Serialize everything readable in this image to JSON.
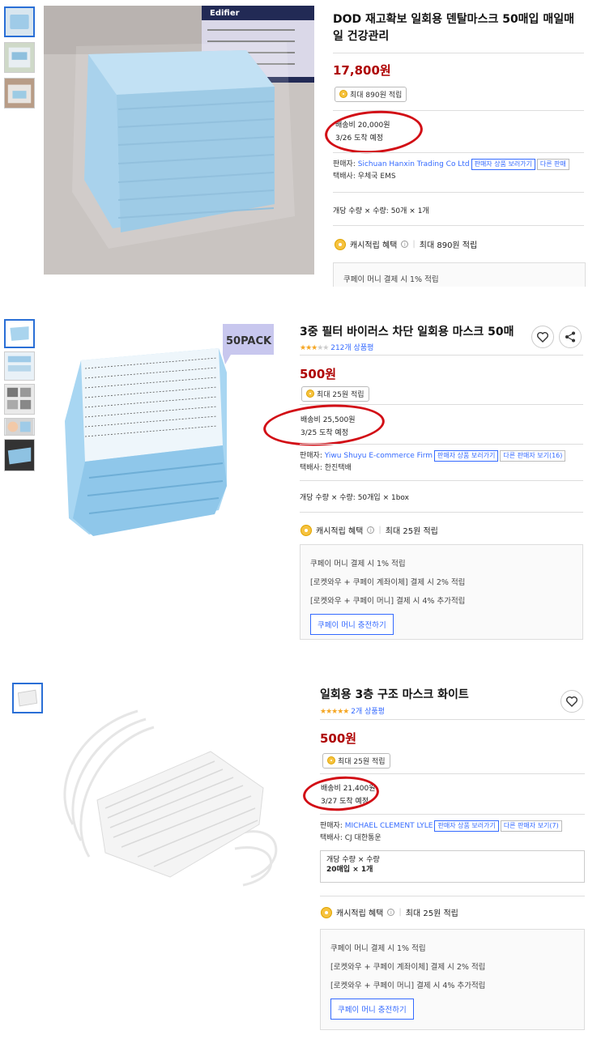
{
  "products": [
    {
      "title": "DOD 재고확보 일회용 덴탈마스크 50매입 매일매일 건강관리",
      "price": "17,800원",
      "reward": "최대 890원 적립",
      "shipping_fee": "배송비 20,000원",
      "arrival": "3/26 도착 예정",
      "seller_label": "판매자:",
      "seller_name": "Sichuan Hanxin Trading Co Ltd",
      "seller_btn": "판매자 상품 보러가기",
      "other_sellers": "다른 판매",
      "carrier": "택배사: 우체국 EMS",
      "quantity": "개당 수량 × 수량: 50개 × 1개",
      "cash_label": "캐시적립 혜택",
      "cash_max": "최대 890원 적립",
      "benefit_line1": "쿠페이 머니 결제 시 1% 적립",
      "box_brand": "Edifier"
    },
    {
      "title": "3중 필터 바이러스 차단 일회용 마스크 50매",
      "rating_count": "212개 상품평",
      "stars": 3,
      "price": "500원",
      "reward": "최대 25원 적립",
      "shipping_fee": "배송비 25,500원",
      "arrival": "3/25 도착 예정",
      "seller_label": "판매자:",
      "seller_name": "Yiwu Shuyu E-commerce Firm",
      "seller_btn": "판매자 상품 보러가기",
      "other_sellers": "다른 판매자 보기(16)",
      "carrier": "택배사: 한진택배",
      "quantity": "개당 수량 × 수량: 50개입 × 1box",
      "cash_label": "캐시적립 혜택",
      "cash_max": "최대 25원 적립",
      "benefit_lines": [
        "쿠페이 머니 결제 시 1% 적립",
        "[로켓와우 + 쿠페이 계좌이체] 결제 시 2% 적립",
        "[로켓와우 + 쿠페이 머니] 결제 시 4% 추가적립"
      ],
      "charge_btn": "쿠페이 머니 충전하기",
      "badge": "50PACK"
    },
    {
      "title": "일회용 3층 구조 마스크 화이트",
      "rating_count": "2개 상품평",
      "stars": 5,
      "price": "500원",
      "reward": "최대 25원 적립",
      "shipping_fee": "배송비 21,400원",
      "arrival": "3/27 도착 예정",
      "seller_label": "판매자:",
      "seller_name": "MICHAEL CLEMENT LYLE",
      "seller_btn": "판매자 상품 보러가기",
      "other_sellers": "다른 판매자 보기(7)",
      "carrier": "택배사: CJ 대한통운",
      "quantity_label": "개당 수량 × 수량",
      "quantity_value": "20매입 × 1개",
      "cash_label": "캐시적립 혜택",
      "cash_max": "최대 25원 적립",
      "benefit_lines": [
        "쿠페이 머니 결제 시 1% 적립",
        "[로켓와우 + 쿠페이 계좌이체] 결제 시 2% 적립",
        "[로켓와우 + 쿠페이 머니] 결제 시 4% 추가적립"
      ],
      "charge_btn": "쿠페이 머니 충전하기"
    }
  ],
  "colors": {
    "price": "#ae0000",
    "link": "#346aff",
    "circle": "#d20d15",
    "star": "#f5a623",
    "mask_blue": "#8ec5e8"
  }
}
